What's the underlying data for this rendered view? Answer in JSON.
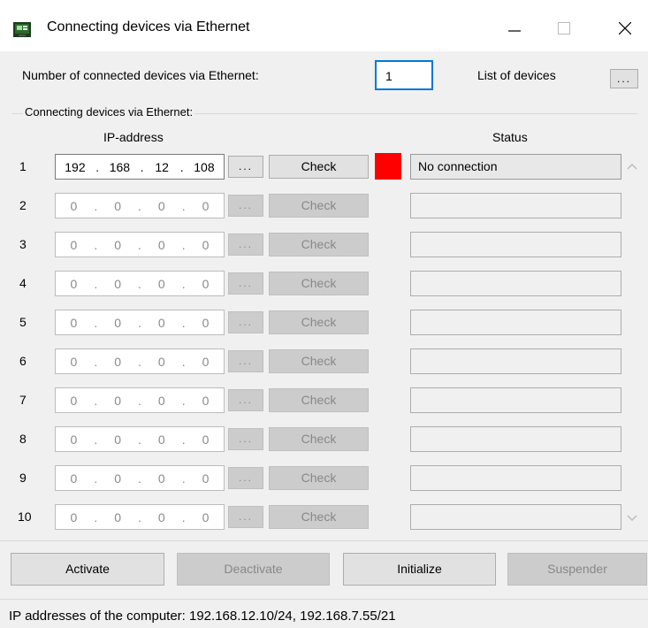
{
  "window": {
    "title": "Connecting devices via Ethernet"
  },
  "header": {
    "count_label": "Number of connected devices via Ethernet:",
    "count_value": "1",
    "list_label": "List of devices",
    "list_button": "..."
  },
  "group": {
    "label": "Connecting devices via Ethernet:",
    "ip_header": "IP-address",
    "status_header": "Status"
  },
  "rows": [
    {
      "num": "1",
      "o1": "192",
      "o2": "168",
      "o3": "12",
      "o4": "108",
      "dots": "...",
      "check": "Check",
      "status": "No connection"
    },
    {
      "num": "2",
      "o1": "0",
      "o2": "0",
      "o3": "0",
      "o4": "0",
      "dots": "...",
      "check": "Check",
      "status": ""
    },
    {
      "num": "3",
      "o1": "0",
      "o2": "0",
      "o3": "0",
      "o4": "0",
      "dots": "...",
      "check": "Check",
      "status": ""
    },
    {
      "num": "4",
      "o1": "0",
      "o2": "0",
      "o3": "0",
      "o4": "0",
      "dots": "...",
      "check": "Check",
      "status": ""
    },
    {
      "num": "5",
      "o1": "0",
      "o2": "0",
      "o3": "0",
      "o4": "0",
      "dots": "...",
      "check": "Check",
      "status": ""
    },
    {
      "num": "6",
      "o1": "0",
      "o2": "0",
      "o3": "0",
      "o4": "0",
      "dots": "...",
      "check": "Check",
      "status": ""
    },
    {
      "num": "7",
      "o1": "0",
      "o2": "0",
      "o3": "0",
      "o4": "0",
      "dots": "...",
      "check": "Check",
      "status": ""
    },
    {
      "num": "8",
      "o1": "0",
      "o2": "0",
      "o3": "0",
      "o4": "0",
      "dots": "...",
      "check": "Check",
      "status": ""
    },
    {
      "num": "9",
      "o1": "0",
      "o2": "0",
      "o3": "0",
      "o4": "0",
      "dots": "...",
      "check": "Check",
      "status": ""
    },
    {
      "num": "10",
      "o1": "0",
      "o2": "0",
      "o3": "0",
      "o4": "0",
      "dots": "...",
      "check": "Check",
      "status": ""
    }
  ],
  "ip_separator": ".",
  "status_indicator_color": "#ff0000",
  "buttons": {
    "activate": "Activate",
    "deactivate": "Deactivate",
    "initialize": "Initialize",
    "suspender": "Suspender"
  },
  "footer": {
    "text": "IP addresses of the computer: 192.168.12.10/24, 192.168.7.55/21"
  },
  "icons": {
    "app": "app-icon",
    "minimize": "minimize-icon",
    "maximize": "maximize-icon",
    "close": "close-icon",
    "scroll_up": "chevron-up-icon",
    "scroll_down": "chevron-down-icon"
  }
}
